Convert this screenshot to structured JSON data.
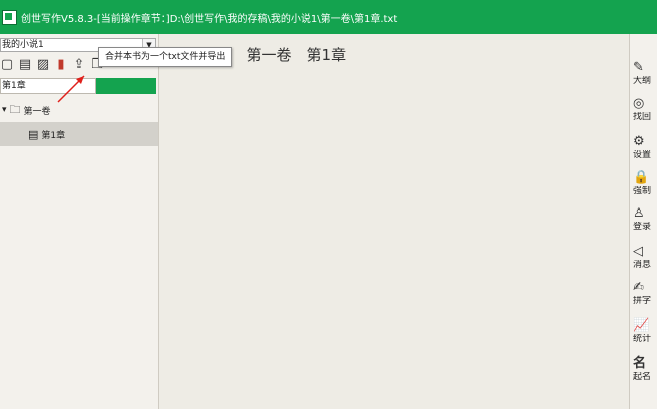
{
  "window": {
    "title": "创世写作V5.8.3-[当前操作章节：]D:\\创世写作\\我的存稿\\我的小说1\\第一卷\\第1章.txt"
  },
  "left_panel": {
    "book_select": {
      "value": "我的小说1"
    },
    "toolbar": [
      {
        "name": "new-chapter",
        "icon": "▢"
      },
      {
        "name": "new-file",
        "icon": "▤"
      },
      {
        "name": "edit",
        "icon": "▨"
      },
      {
        "name": "delete",
        "icon": "▮"
      },
      {
        "name": "export",
        "icon": "⇪"
      },
      {
        "name": "copy",
        "icon": "❐"
      },
      {
        "name": "undo",
        "icon": "↶"
      }
    ],
    "chapter_field": {
      "value": "第1章"
    },
    "tooltip": "合并本书为一个txt文件并导出",
    "tree": {
      "volume_label": "第一卷",
      "chapter_label": "第1章"
    }
  },
  "editor": {
    "heading": "我的小说1　第一卷　第1章"
  },
  "right_sidebar": {
    "items": [
      {
        "label": "大纲",
        "icon": "✎"
      },
      {
        "label": "找回",
        "icon": "◎"
      },
      {
        "label": "设置",
        "icon": "⚙"
      },
      {
        "label": "强制",
        "icon": "🔒"
      },
      {
        "label": "登录",
        "icon": "♙"
      },
      {
        "label": "消息",
        "icon": "◁"
      },
      {
        "label": "拼字",
        "icon": "✍"
      },
      {
        "label": "统计",
        "icon": "📈"
      },
      {
        "label": "起名",
        "icon": "名"
      }
    ]
  },
  "colors": {
    "titlebar": "#14a34f",
    "tooltip_arrow": "#e0201b"
  }
}
